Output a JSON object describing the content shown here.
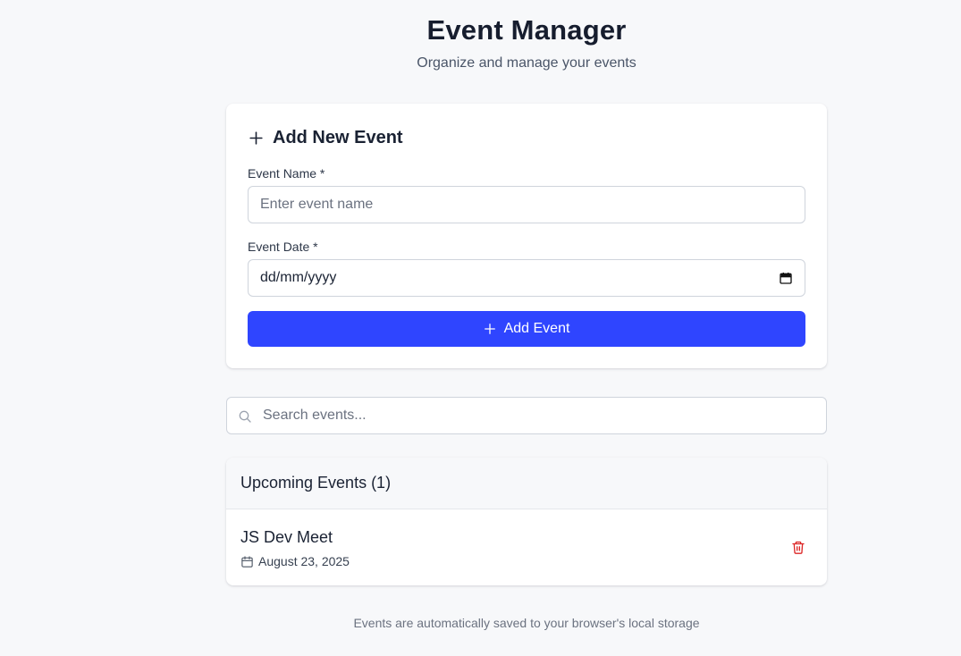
{
  "header": {
    "title": "Event Manager",
    "subtitle": "Organize and manage your events"
  },
  "form": {
    "heading": "Add New Event",
    "heading_icon": "plus-icon",
    "name_label": "Event Name *",
    "name_placeholder": "Enter event name",
    "name_value": "",
    "date_label": "Event Date *",
    "date_placeholder": "dd/mm/yyyy",
    "date_icon": "calendar-icon",
    "submit_label": "Add Event",
    "submit_icon": "plus-icon",
    "submit_color": "#2f45ff"
  },
  "search": {
    "placeholder": "Search events...",
    "value": "",
    "icon": "search-icon"
  },
  "events": {
    "header": "Upcoming Events (1)",
    "items": [
      {
        "name": "JS Dev Meet",
        "date": "August 23, 2025",
        "date_icon": "calendar-icon",
        "delete_icon": "trash-icon",
        "delete_color": "#dc2626"
      }
    ]
  },
  "footer": {
    "note": "Events are automatically saved to your browser's local storage"
  }
}
